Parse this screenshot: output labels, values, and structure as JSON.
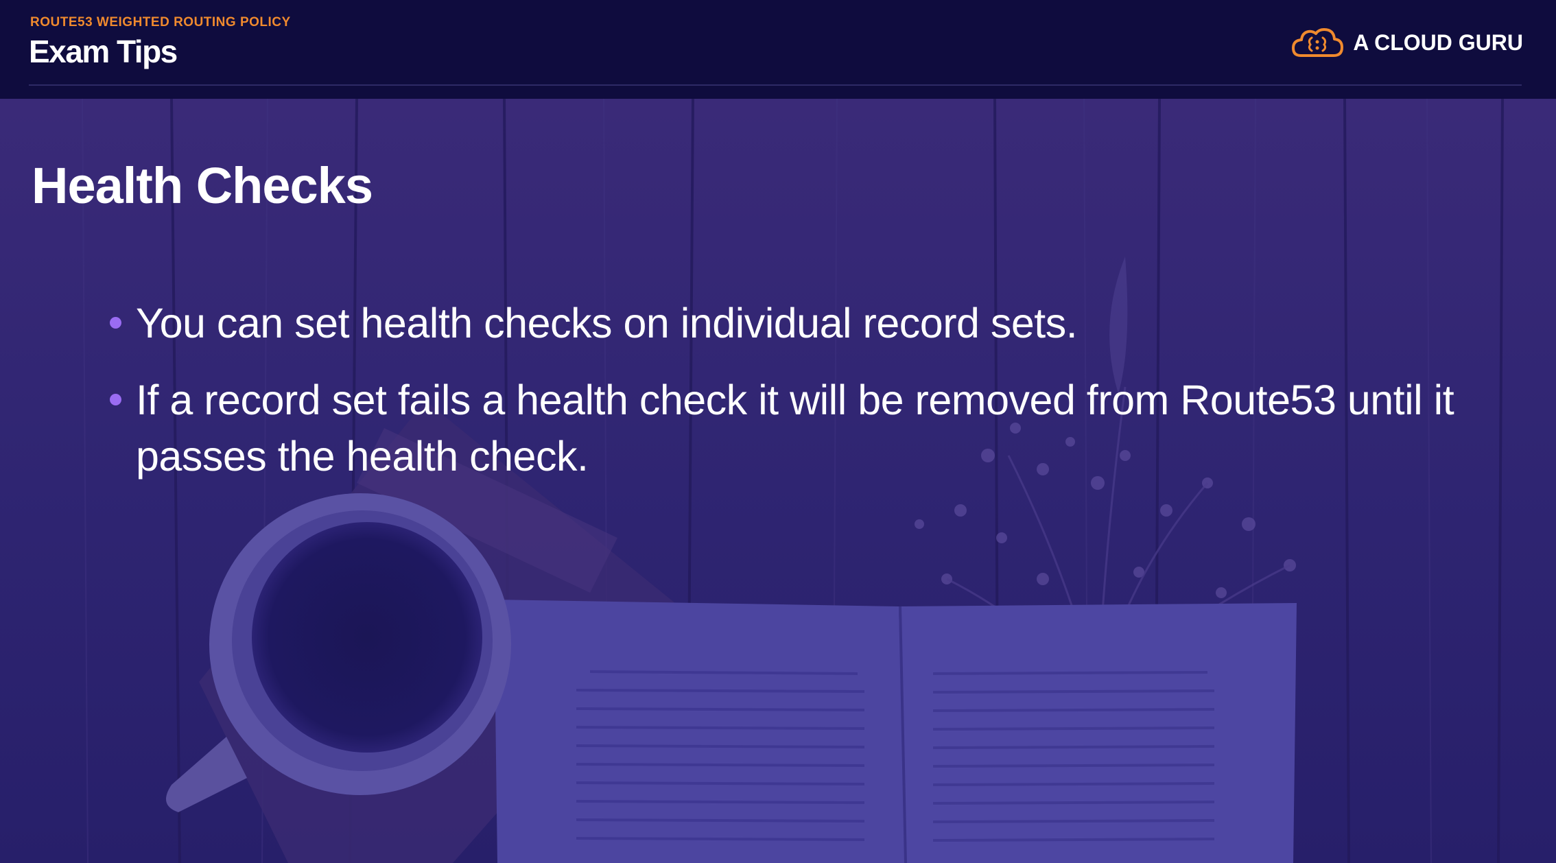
{
  "header": {
    "section_tag": "ROUTE53  WEIGHTED ROUTING POLICY",
    "title": "Exam Tips",
    "brand_name": "A CLOUD GURU",
    "brand_logo_icon": "cloud-brain-logo-icon",
    "accent_color": "#f08a2e"
  },
  "slide": {
    "heading": "Health Checks",
    "bullets": [
      "You can set health checks on individual record sets.",
      "If a record set fails a health check it will be removed from Route53 until it passes the health check."
    ],
    "bullet_color": "#9a6cf2"
  },
  "background": {
    "image": "coffee-cup-and-open-book-on-wooden-table",
    "overlay_color": "#2b2273"
  }
}
